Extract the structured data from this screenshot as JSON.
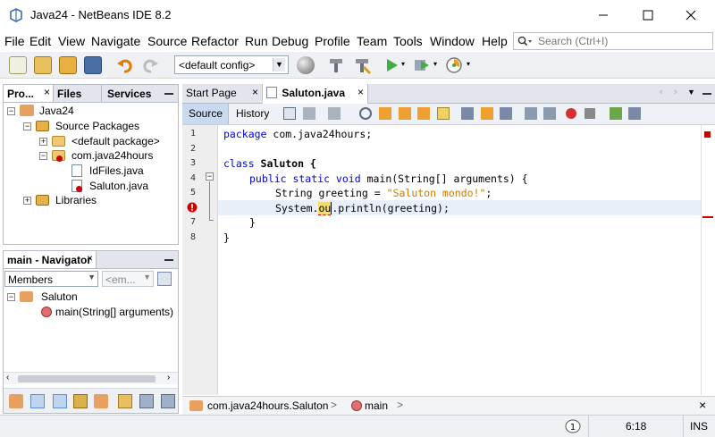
{
  "window": {
    "title": "Java24 - NetBeans IDE 8.2"
  },
  "menu": [
    "File",
    "Edit",
    "View",
    "Navigate",
    "Source",
    "Refactor",
    "Run",
    "Debug",
    "Profile",
    "Team",
    "Tools",
    "Window",
    "Help"
  ],
  "search": {
    "placeholder": "Search (Ctrl+I)"
  },
  "toolbar": {
    "config": "<default config>"
  },
  "projects_panel": {
    "tabs": [
      "Pro...",
      "Files",
      "Services"
    ],
    "tree": [
      {
        "label": "Java24",
        "depth": 0
      },
      {
        "label": "Source Packages",
        "depth": 1
      },
      {
        "label": "<default package>",
        "depth": 2
      },
      {
        "label": "com.java24hours",
        "depth": 2
      },
      {
        "label": "IdFiles.java",
        "depth": 3
      },
      {
        "label": "Saluton.java",
        "depth": 3
      },
      {
        "label": "Libraries",
        "depth": 1
      }
    ]
  },
  "navigator": {
    "title": "main - Navigator",
    "filter": "Members",
    "filter2": "<em...",
    "tree": [
      {
        "label": "Saluton"
      },
      {
        "label": "main(String[] arguments)"
      }
    ]
  },
  "editor": {
    "tabs": [
      "Start Page",
      "Saluton.java"
    ],
    "toolbar": {
      "source": "Source",
      "history": "History"
    },
    "line_numbers": [
      "1",
      "2",
      "3",
      "4",
      "5",
      "6",
      "7",
      "8"
    ],
    "code": {
      "l1_kw": "package",
      "l1_rest": " com.java24hours;",
      "l3_kw": "class",
      "l3_rest": " Saluton {",
      "l4_kw": "public static void",
      "l4_rest": " main(String[] arguments) {",
      "l5_a": "String greeting = ",
      "l5_str": "\"Saluton mondo!\"",
      "l5_b": ";",
      "l6_a": "System.",
      "l6_hl": "ou",
      "l6_b": ".println(greeting);",
      "l7": "}",
      "l8": "}"
    }
  },
  "breadcrumb": {
    "class": "com.java24hours.Saluton",
    "method": "main"
  },
  "status": {
    "position": "6:18",
    "mode": "INS"
  },
  "colors": {
    "accent": "#5b8fd6",
    "keyword": "#0000e6",
    "string": "#ce7b00",
    "error": "#cc0000"
  }
}
